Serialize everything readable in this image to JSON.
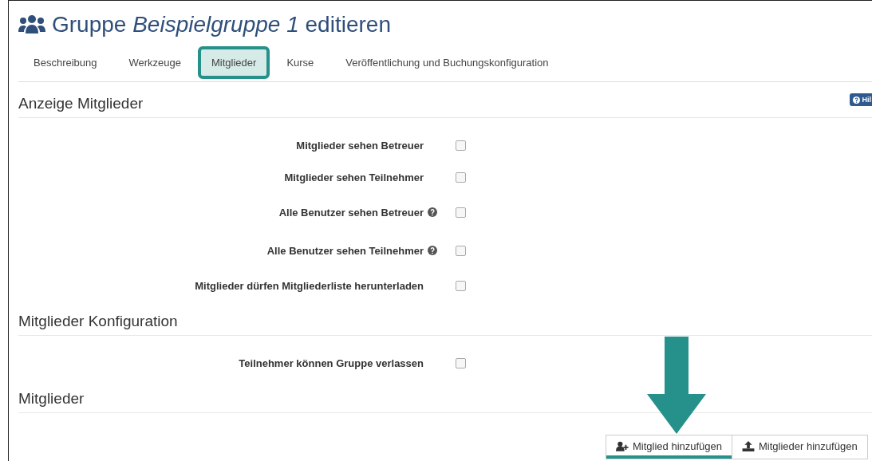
{
  "title": {
    "prefix": "Gruppe",
    "name": "Beispielgruppe 1",
    "suffix": "editieren"
  },
  "tabs": [
    {
      "label": "Beschreibung",
      "selected": false
    },
    {
      "label": "Werkzeuge",
      "selected": false
    },
    {
      "label": "Mitglieder",
      "selected": true
    },
    {
      "label": "Kurse",
      "selected": false
    },
    {
      "label": "Veröffentlichung und Buchungskonfiguration",
      "selected": false
    }
  ],
  "sections": [
    {
      "heading": "Anzeige Mitglieder",
      "help_button": "Hil",
      "options": [
        {
          "label": "Mitglieder sehen Betreuer",
          "help": false,
          "checked": false
        },
        {
          "label": "Mitglieder sehen Teilnehmer",
          "help": false,
          "checked": false
        },
        {
          "label": "Alle Benutzer sehen Betreuer",
          "help": true,
          "checked": false
        },
        {
          "label": "Alle Benutzer sehen Teilnehmer",
          "help": true,
          "checked": false
        },
        {
          "label": "Mitglieder dürfen Mitgliederliste herunterladen",
          "help": false,
          "checked": false
        }
      ]
    },
    {
      "heading": "Mitglieder Konfiguration",
      "options": [
        {
          "label": "Teilnehmer können Gruppe verlassen",
          "help": false,
          "checked": false
        }
      ]
    },
    {
      "heading": "Mitglieder"
    }
  ],
  "actions": [
    {
      "label": "Mitglied hinzufügen",
      "kind": "add-user",
      "highlighted": true
    },
    {
      "label": "Mitglieder hinzufügen",
      "kind": "upload",
      "highlighted": false
    }
  ]
}
